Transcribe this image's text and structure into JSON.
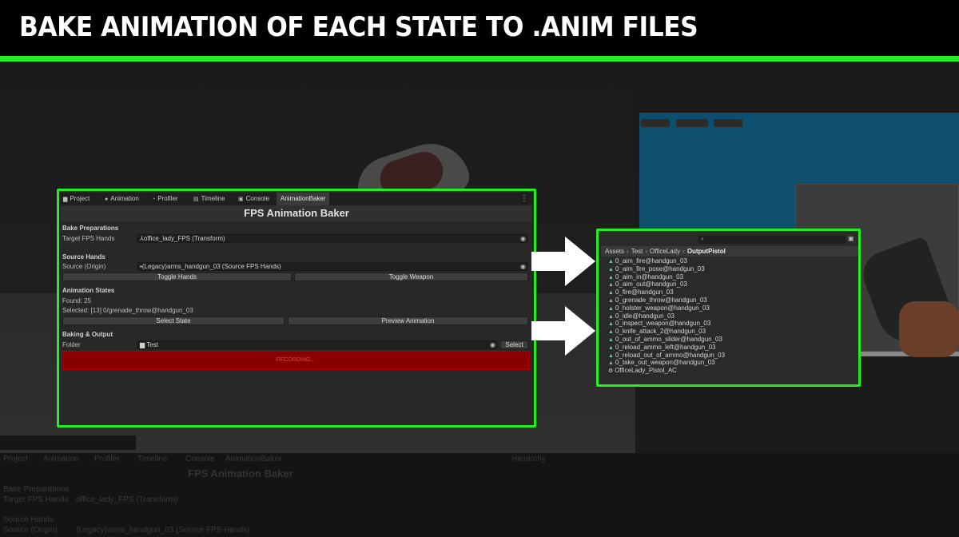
{
  "header": {
    "title": "BAKE ANIMATION OF EACH STATE TO .ANIM FILES"
  },
  "colors": {
    "accent": "#22ee22",
    "record": "#8a0000",
    "sky": "#0e4f6e"
  },
  "tabs": [
    {
      "label": "Project",
      "icon": "folder-icon"
    },
    {
      "label": "Animation",
      "icon": "clock-icon"
    },
    {
      "label": "Profiler",
      "icon": "gauge-icon"
    },
    {
      "label": "Timeline",
      "icon": "timeline-icon"
    },
    {
      "label": "Console",
      "icon": "console-icon"
    },
    {
      "label": "AnimationBaker",
      "icon": ""
    }
  ],
  "baker": {
    "title": "FPS Animation Baker",
    "bake_preparations": {
      "heading": "Bake Preparations",
      "target_label": "Target FPS Hands",
      "target_value": "office_lady_FPS (Transform)"
    },
    "source_hands": {
      "heading": "Source Hands",
      "source_label": "Source (Origin)",
      "source_value": "(Legacy)arms_handgun_03 (Source FPS Hands)",
      "toggle_hands": "Toggle Hands",
      "toggle_weapon": "Toggle Weapon"
    },
    "animation_states": {
      "heading": "Animation States",
      "found": "Found: 25",
      "selected": "Selected: [13] 0/grenade_throw@handgun_03",
      "select_state": "Select State",
      "preview_animation": "Preview Animation"
    },
    "baking_output": {
      "heading": "Baking & Output",
      "folder_label": "Folder",
      "folder_value": "Test",
      "select_button": "Select"
    },
    "recording": "RECORDING..."
  },
  "project": {
    "search_placeholder": "",
    "breadcrumb": [
      "Assets",
      "Test",
      "OfficeLady",
      "OutputPistol"
    ],
    "files": [
      {
        "name": "0_aim_fire@handgun_03",
        "icon": "animation-clip-icon"
      },
      {
        "name": "0_aim_fire_pose@handgun_03",
        "icon": "animation-clip-icon"
      },
      {
        "name": "0_aim_in@handgun_03",
        "icon": "animation-clip-icon"
      },
      {
        "name": "0_aim_out@handgun_03",
        "icon": "animation-clip-icon"
      },
      {
        "name": "0_fire@handgun_03",
        "icon": "animation-clip-icon"
      },
      {
        "name": "0_grenade_throw@handgun_03",
        "icon": "animation-clip-icon"
      },
      {
        "name": "0_holster_weapon@handgun_03",
        "icon": "animation-clip-icon"
      },
      {
        "name": "0_idle@handgun_03",
        "icon": "animation-clip-icon"
      },
      {
        "name": "0_inspect_weapon@handgun_03",
        "icon": "animation-clip-icon"
      },
      {
        "name": "0_knife_attack_2@handgun_03",
        "icon": "animation-clip-icon"
      },
      {
        "name": "0_out_of_ammo_slider@handgun_03",
        "icon": "animation-clip-icon"
      },
      {
        "name": "0_reload_ammo_left@handgun_03",
        "icon": "animation-clip-icon"
      },
      {
        "name": "0_reload_out_of_ammo@handgun_03",
        "icon": "animation-clip-icon"
      },
      {
        "name": "0_take_out_weapon@handgun_03",
        "icon": "animation-clip-icon"
      },
      {
        "name": "OfficeLady_Pistol_AC",
        "icon": "animator-controller-icon"
      }
    ]
  },
  "background": {
    "ghost_title": "FPS Animation Baker",
    "ghost_tabs": [
      "Project",
      "Animation",
      "Profiler",
      "Timeline",
      "Console",
      "AnimationBaker"
    ],
    "ghost_sections": [
      "Bake Preparations",
      "Target FPS Hands",
      "office_lady_FPS (Transform)",
      "Source Hands",
      "Source (Origin)",
      "(Legacy)arms_handgun_03 (Source FPS Hands)"
    ],
    "ghost_hierarchy": "Hierarchy"
  }
}
